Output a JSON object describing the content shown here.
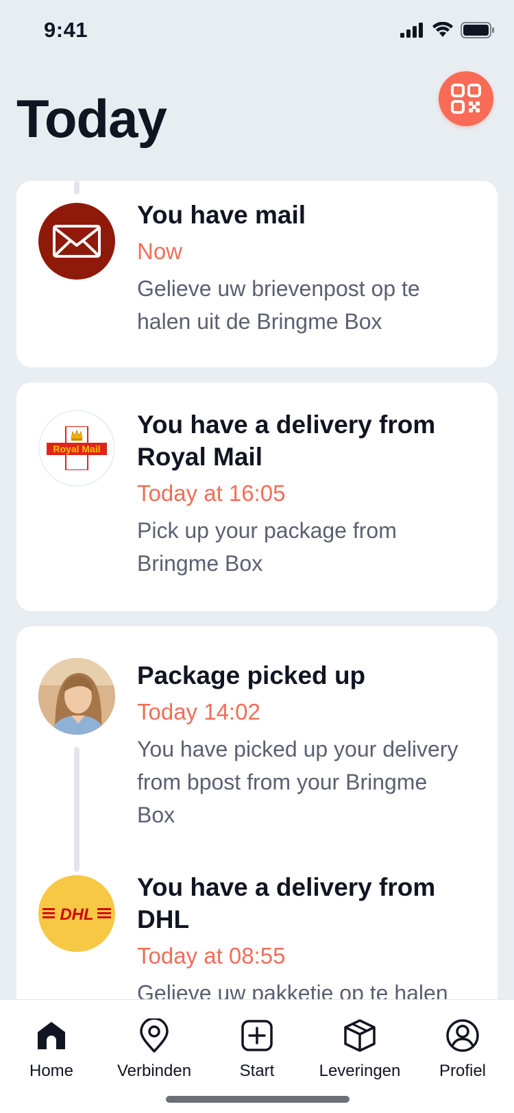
{
  "status_bar": {
    "time": "9:41"
  },
  "header": {
    "title": "Today"
  },
  "feed": [
    {
      "title": "You have mail",
      "time": "Now",
      "description": "Gelieve uw brievenpost op te halen uit de Bringme Box",
      "icon": "envelope-icon",
      "avatar_color": "#8f1a0a"
    },
    {
      "title": "You have a delivery from Royal Mail",
      "time": "Today at 16:05",
      "description": "Pick up your package from Bringme Box",
      "logo_text": "Royal Mail",
      "icon": "royal-mail-logo"
    },
    {
      "title": "Package picked up",
      "time": "Today 14:02",
      "description": "You have picked up your delivery from bpost from your Bringme Box",
      "icon": "user-photo"
    },
    {
      "title": "You have a delivery from DHL",
      "time": "Today at 08:55",
      "description": "Gelieve uw pakketje op te halen",
      "logo_text": "DHL",
      "icon": "dhl-logo",
      "avatar_color": "#f7c843"
    }
  ],
  "bottom_nav": {
    "items": [
      {
        "label": "Home",
        "icon": "home-icon",
        "active": true
      },
      {
        "label": "Verbinden",
        "icon": "location-pin-icon"
      },
      {
        "label": "Start",
        "icon": "plus-square-icon"
      },
      {
        "label": "Leveringen",
        "icon": "package-icon"
      },
      {
        "label": "Profiel",
        "icon": "user-circle-icon"
      }
    ]
  },
  "colors": {
    "accent": "#f86b56",
    "time_text": "#f26d57",
    "background": "#e8edf2"
  }
}
